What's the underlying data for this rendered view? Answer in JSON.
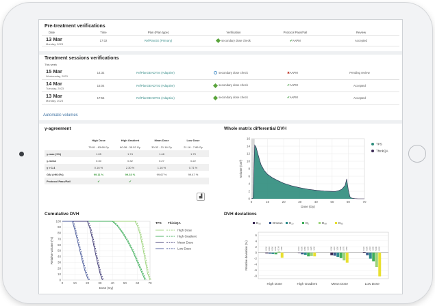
{
  "pre_treatment": {
    "title": "Pre-treatment verifications",
    "columns": [
      "Date",
      "Time",
      "Plan (Plan type)",
      "Verification",
      "Protocol Pass/Fail",
      "Review"
    ],
    "rows": [
      {
        "date": "13 Mar",
        "day": "Monday, 2023",
        "time": "17:02",
        "plan": "RefPlanGE (Primary)",
        "verification": "secondary dose check",
        "protocol": "AAPM",
        "protocol_status": "pass",
        "review": "Accepted",
        "verif_icon": "diamond-ok"
      }
    ]
  },
  "sessions": {
    "title": "Treatment sessions verifications",
    "this_week": "This week",
    "rows": [
      {
        "date": "15 Mar",
        "day": "Wednesday, 2023",
        "time": "14:32",
        "plan": "RefPlanGEADT04 (Adaptive)",
        "verification": "secondary dose check",
        "protocol": "AAPM",
        "protocol_status": "fail",
        "review": "Pending review",
        "verif_icon": "clock"
      },
      {
        "date": "14 Mar",
        "day": "Tuesday, 2023",
        "time": "15:04",
        "plan": "RefPlanGEADT03 (Adaptive)",
        "verification": "secondary dose check",
        "protocol": "AAPM",
        "protocol_status": "pass",
        "review": "Accepted",
        "verif_icon": "diamond-ok"
      },
      {
        "date": "13 Mar",
        "day": "Monday, 2023",
        "time": "17:56",
        "plan": "RefPlanGEADT01 (Adaptive)",
        "verification": "secondary dose check",
        "protocol": "AAPM",
        "protocol_status": "pass",
        "review": "Accepted",
        "verif_icon": "diamond-ok"
      }
    ]
  },
  "automatic_volumes": "Automatic volumes",
  "gamma": {
    "title": "γ-agreement",
    "columns": [
      "High Dose",
      "High Gradient",
      "Mean Dose",
      "Low Dose"
    ],
    "ranges": [
      "75.81 - 83.68 Gy",
      "60.08 - 35.52 Gy",
      "30.32 - 21.16 Gy",
      "21.16 - 7.86 Gy"
    ],
    "rows": [
      {
        "label": "γ-max (1%)",
        "values": [
          "1.05",
          "1.74",
          "1.48",
          "1.79"
        ]
      },
      {
        "label": "γ-mean",
        "values": [
          "0.30",
          "0.32",
          "0.27",
          "0.22"
        ]
      },
      {
        "label": "γ > 1.4",
        "values": [
          "0.16 %",
          "2.30 %",
          "1.16 %",
          "0.71 %"
        ]
      },
      {
        "label": "GAI (>90.0%)",
        "values": [
          "99.11 %",
          "99.33 %",
          "99.67 %",
          "99.47 %"
        ]
      },
      {
        "label": "Protocol Pass/Fail",
        "values": [
          "✔",
          "✔",
          "",
          ""
        ]
      }
    ]
  },
  "whole_dvh": {
    "title": "Whole matrix differential DVH",
    "legend": [
      "TPS",
      "ThinkQA"
    ],
    "xlabel": "Dose (Gy)",
    "ylabel": "Volume (cm³)",
    "colors": {
      "tps": "#2e8c7c",
      "thinkqa": "#3b2a55"
    }
  },
  "cumulative_dvh": {
    "title": "Cumulative DVH",
    "legend_header": [
      "TPS",
      "ThinkQA"
    ],
    "legend": [
      "High Dose",
      "High Gradient",
      "Mean Dose",
      "Low Dose"
    ],
    "xlabel": "Dose (Gy)",
    "ylabel": "Relative volume (%)",
    "colors": {
      "high_dose": "#9bd37a",
      "high_gradient": "#3fae5a",
      "mean_dose": "#3a3470",
      "low_dose": "#4a5a9a"
    }
  },
  "dvh_deviations": {
    "title": "DVH deviations",
    "legend": [
      "D₅₀",
      "Dmean",
      "D₁₀",
      "D₂",
      "D₉₈",
      "D₉₅"
    ],
    "ylabel": "Relative deviation (%)",
    "categories": [
      "High Dose",
      "High Gradient",
      "Mean Dose",
      "Low Dose"
    ],
    "colors": [
      "#3b2a55",
      "#3a5a8c",
      "#2e8c8c",
      "#3fae5a",
      "#9bd37a",
      "#e8e030"
    ]
  },
  "chart_data": [
    {
      "type": "area",
      "title": "Whole matrix differential DVH",
      "xlabel": "Dose (Gy)",
      "ylabel": "Volume (cm³)",
      "xlim": [
        0,
        70
      ],
      "ylim": [
        0,
        16
      ],
      "xticks": [
        0,
        10,
        20,
        30,
        40,
        50,
        60,
        70
      ],
      "yticks": [
        0,
        2,
        4,
        6,
        8,
        10,
        12,
        14,
        16
      ],
      "series": [
        {
          "name": "TPS",
          "x": [
            0,
            1,
            2,
            3,
            4,
            5,
            6,
            8,
            10,
            13,
            16,
            20,
            25,
            30,
            35,
            40,
            45,
            50,
            52,
            54,
            56,
            58,
            59,
            60,
            61,
            62,
            64,
            66,
            68,
            70
          ],
          "y": [
            0,
            0.2,
            14.5,
            13.8,
            12.2,
            10.6,
            9.2,
            7.6,
            6.6,
            5.7,
            5.0,
            4.2,
            3.5,
            3.0,
            2.6,
            2.3,
            2.1,
            2.0,
            2.0,
            2.2,
            2.6,
            3.6,
            5.4,
            2.5,
            0.6,
            0.2,
            0.05,
            0,
            0,
            0
          ]
        }
      ],
      "legend": [
        "TPS",
        "ThinkQA"
      ],
      "grid": true
    },
    {
      "type": "line",
      "title": "Cumulative DVH",
      "xlabel": "Dose (Gy)",
      "ylabel": "Relative volume (%)",
      "xlim": [
        0,
        70
      ],
      "ylim": [
        0,
        100
      ],
      "xticks": [
        0,
        10,
        20,
        30,
        40,
        50,
        60,
        70
      ],
      "yticks": [
        0,
        10,
        20,
        30,
        40,
        50,
        60,
        70,
        80,
        90,
        100
      ],
      "series": [
        {
          "name": "High Dose",
          "x": [
            0,
            58,
            60,
            62,
            64,
            66,
            68,
            70
          ],
          "y": [
            100,
            100,
            92,
            78,
            58,
            35,
            12,
            0
          ]
        },
        {
          "name": "High Gradient",
          "x": [
            0,
            40,
            44,
            48,
            52,
            56,
            60,
            64,
            66
          ],
          "y": [
            100,
            100,
            92,
            80,
            66,
            50,
            30,
            10,
            0
          ]
        },
        {
          "name": "Mean Dose",
          "x": [
            0,
            20,
            22,
            24,
            26,
            28,
            30,
            32
          ],
          "y": [
            100,
            100,
            88,
            70,
            50,
            30,
            12,
            0
          ]
        },
        {
          "name": "Low Dose",
          "x": [
            0,
            8,
            10,
            12,
            14,
            16,
            18,
            20,
            21
          ],
          "y": [
            100,
            100,
            85,
            68,
            50,
            32,
            16,
            4,
            0
          ]
        }
      ],
      "legend": [
        "High Dose",
        "High Gradient",
        "Mean Dose",
        "Low Dose"
      ],
      "grid": true
    },
    {
      "type": "bar",
      "title": "DVH deviations",
      "ylabel": "Relative deviation (%)",
      "categories": [
        "High Dose",
        "High Gradient",
        "Mean Dose",
        "Low Dose"
      ],
      "ylim": [
        -9,
        7
      ],
      "yticks": [
        -8,
        -6,
        -4,
        -2,
        0,
        2,
        4,
        6
      ],
      "series": [
        {
          "name": "D₅₀",
          "values": [
            -0.3,
            -0.1,
            -0.9,
            0.2
          ]
        },
        {
          "name": "Dmean",
          "values": [
            -0.4,
            -0.6,
            -1.1,
            -0.9
          ]
        },
        {
          "name": "D₁₀",
          "values": [
            -0.5,
            -0.8,
            -1.5,
            -2.1
          ]
        },
        {
          "name": "D₂",
          "values": [
            -0.6,
            -1.3,
            -1.9,
            -3.0
          ]
        },
        {
          "name": "D₉₈",
          "values": [
            0.3,
            -1.2,
            -2.7,
            -5.0
          ]
        },
        {
          "name": "D₉₅",
          "values": [
            -1.8,
            -1.3,
            -3.5,
            -8.2
          ]
        }
      ],
      "legend": [
        "D₅₀",
        "Dmean",
        "D₁₀",
        "D₂",
        "D₉₈",
        "D₉₅"
      ],
      "grid": true
    }
  ]
}
